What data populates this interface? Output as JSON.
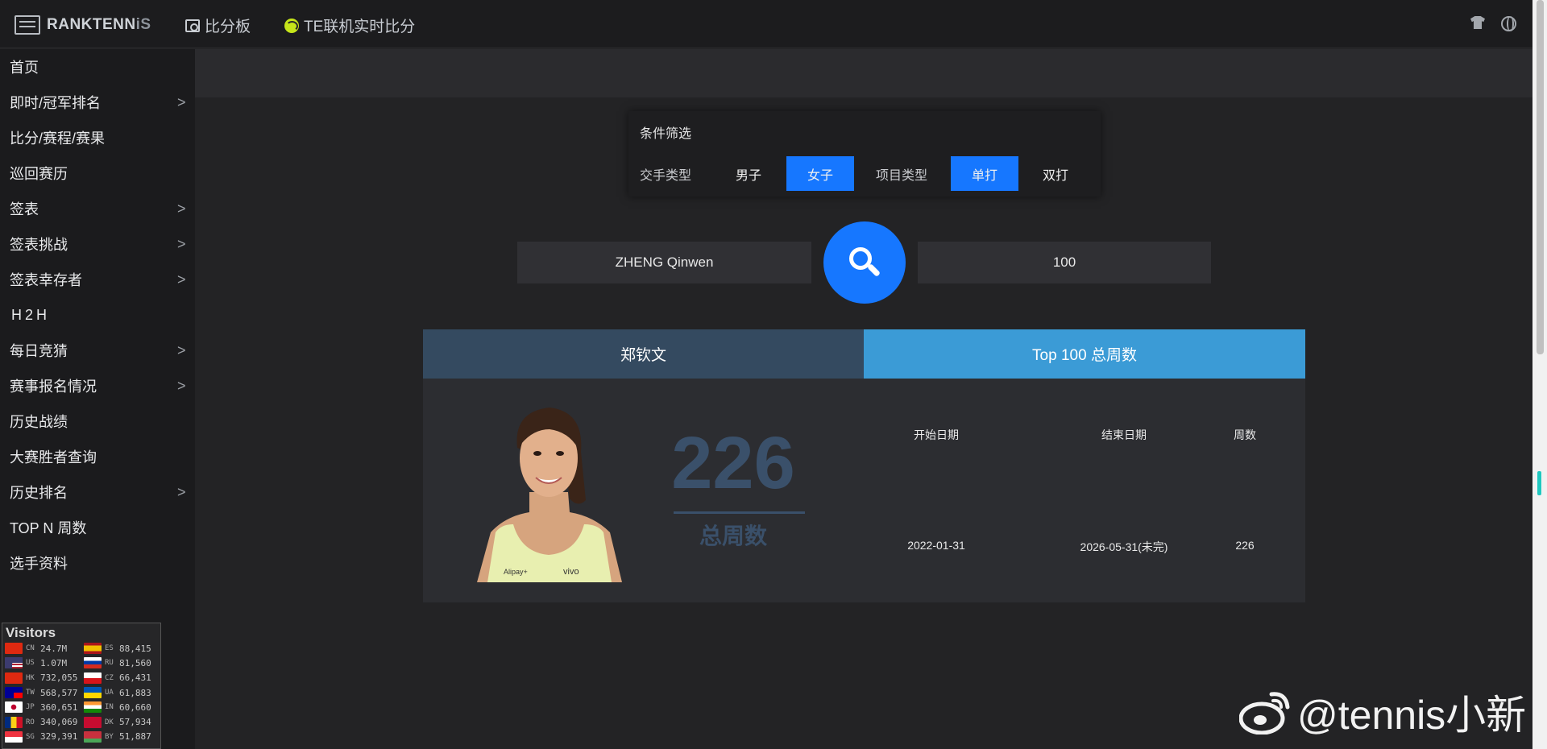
{
  "app": {
    "logo_main": "RANKTENN",
    "logo_accent": "iS"
  },
  "topnav": {
    "scoreboard": "比分板",
    "live": "TE联机实时比分"
  },
  "sidebar": {
    "items": [
      {
        "label": "首页",
        "has_children": false
      },
      {
        "label": "即时/冠军排名",
        "has_children": true
      },
      {
        "label": "比分/赛程/赛果",
        "has_children": false
      },
      {
        "label": "巡回赛历",
        "has_children": false
      },
      {
        "label": "签表",
        "has_children": true
      },
      {
        "label": "签表挑战",
        "has_children": true
      },
      {
        "label": "签表幸存者",
        "has_children": true
      },
      {
        "label": "H2H",
        "has_children": false
      },
      {
        "label": "每日竞猜",
        "has_children": true
      },
      {
        "label": "赛事报名情况",
        "has_children": true
      },
      {
        "label": "历史战绩",
        "has_children": false
      },
      {
        "label": "大赛胜者查询",
        "has_children": false
      },
      {
        "label": "历史排名",
        "has_children": true
      },
      {
        "label": "TOP N 周数",
        "has_children": false
      },
      {
        "label": "选手资料",
        "has_children": false
      }
    ],
    "chevron": ">"
  },
  "visitors": {
    "title": "Visitors",
    "left": [
      {
        "code": "CN",
        "count": "24.7M",
        "flag": "cn"
      },
      {
        "code": "US",
        "count": "1.07M",
        "flag": "us"
      },
      {
        "code": "HK",
        "count": "732,055",
        "flag": "hk"
      },
      {
        "code": "TW",
        "count": "568,577",
        "flag": "tw"
      },
      {
        "code": "JP",
        "count": "360,651",
        "flag": "jp"
      },
      {
        "code": "RO",
        "count": "340,069",
        "flag": "ro"
      },
      {
        "code": "SG",
        "count": "329,391",
        "flag": "sg"
      }
    ],
    "right": [
      {
        "code": "ES",
        "count": "88,415",
        "flag": "es"
      },
      {
        "code": "RU",
        "count": "81,560",
        "flag": "ru"
      },
      {
        "code": "CZ",
        "count": "66,431",
        "flag": "cz"
      },
      {
        "code": "UA",
        "count": "61,883",
        "flag": "ua"
      },
      {
        "code": "IN",
        "count": "60,660",
        "flag": "in"
      },
      {
        "code": "DK",
        "count": "57,934",
        "flag": "dk"
      },
      {
        "code": "BY",
        "count": "51,887",
        "flag": "by"
      }
    ]
  },
  "filter": {
    "title": "条件筛选",
    "player_type_label": "交手类型",
    "men": "男子",
    "women": "女子",
    "event_type_label": "项目类型",
    "singles": "单打",
    "doubles": "双打",
    "selected_player_type": "女子",
    "selected_event_type": "单打"
  },
  "search": {
    "player_name": "ZHENG Qinwen",
    "top_n": "100"
  },
  "result": {
    "player_cn": "郑钦文",
    "stat_tab": "Top 100 总周数",
    "total_weeks": "226",
    "total_label": "总周数",
    "table": {
      "headers": [
        "开始日期",
        "结束日期",
        "周数"
      ],
      "rows": [
        [
          "2022-01-31",
          "2026-05-31(未完)",
          "226"
        ]
      ]
    }
  },
  "watermark": "@tennis小新",
  "colors": {
    "accent": "#1677ff",
    "tab_name": "#344a60",
    "tab_stat": "#3b9bd6",
    "stat_text": "#3a506a"
  }
}
